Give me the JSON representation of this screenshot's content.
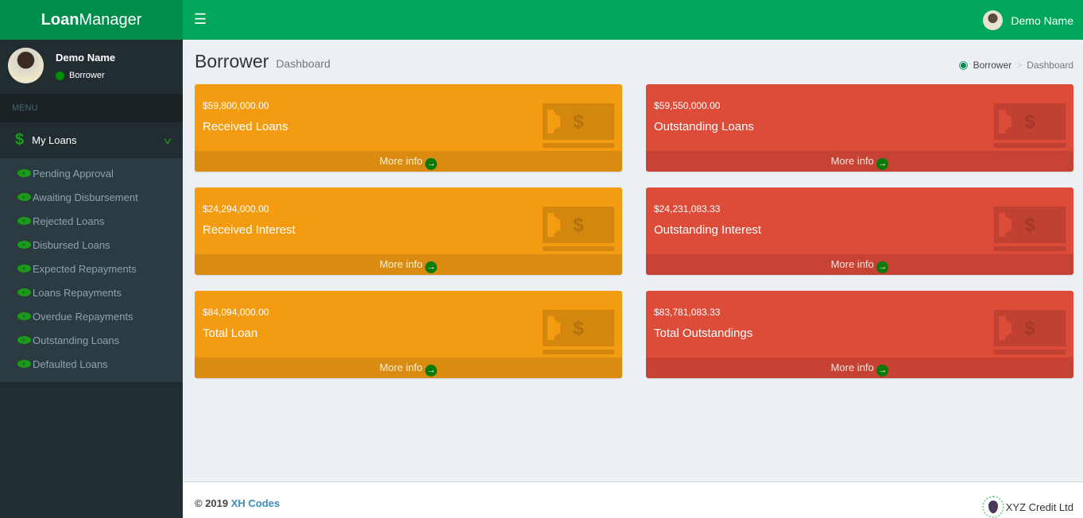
{
  "app": {
    "logo_bold": "Loan",
    "logo_rest": "Manager"
  },
  "topbar": {
    "user_name": "Demo Name"
  },
  "sidebar": {
    "user_name": "Demo Name",
    "role": "Borrower",
    "menu_header": "MENU",
    "main_item": "My Loans",
    "items": [
      "Pending Approval",
      "Awaiting Disbursement",
      "Rejected Loans",
      "Disbursed Loans",
      "Expected Repayments",
      "Loans Repayments",
      "Overdue Repayments",
      "Outstanding Loans",
      "Defaulted Loans"
    ]
  },
  "page": {
    "title": "Borrower",
    "subtitle": "Dashboard",
    "breadcrumb": [
      "Borrower",
      "Dashboard"
    ]
  },
  "cards": [
    {
      "amount": "$59,800,000.00",
      "label": "Received Loans",
      "more": "More info"
    },
    {
      "amount": "$59,550,000.00",
      "label": "Outstanding Loans",
      "more": "More info"
    },
    {
      "amount": "$24,294,000.00",
      "label": "Received Interest",
      "more": "More info"
    },
    {
      "amount": "$24,231,083.33",
      "label": "Outstanding Interest",
      "more": "More info"
    },
    {
      "amount": "$84,094,000.00",
      "label": "Total Loan",
      "more": "More info"
    },
    {
      "amount": "$83,781,083.33",
      "label": "Total Outstandings",
      "more": "More info"
    }
  ],
  "colors": {
    "green": "#00a65a",
    "orange": "#f39c12",
    "red": "#dd4b39"
  },
  "footer": {
    "copy": "© 2019",
    "company": "XH Codes",
    "brand": "XYZ Credit Ltd"
  }
}
